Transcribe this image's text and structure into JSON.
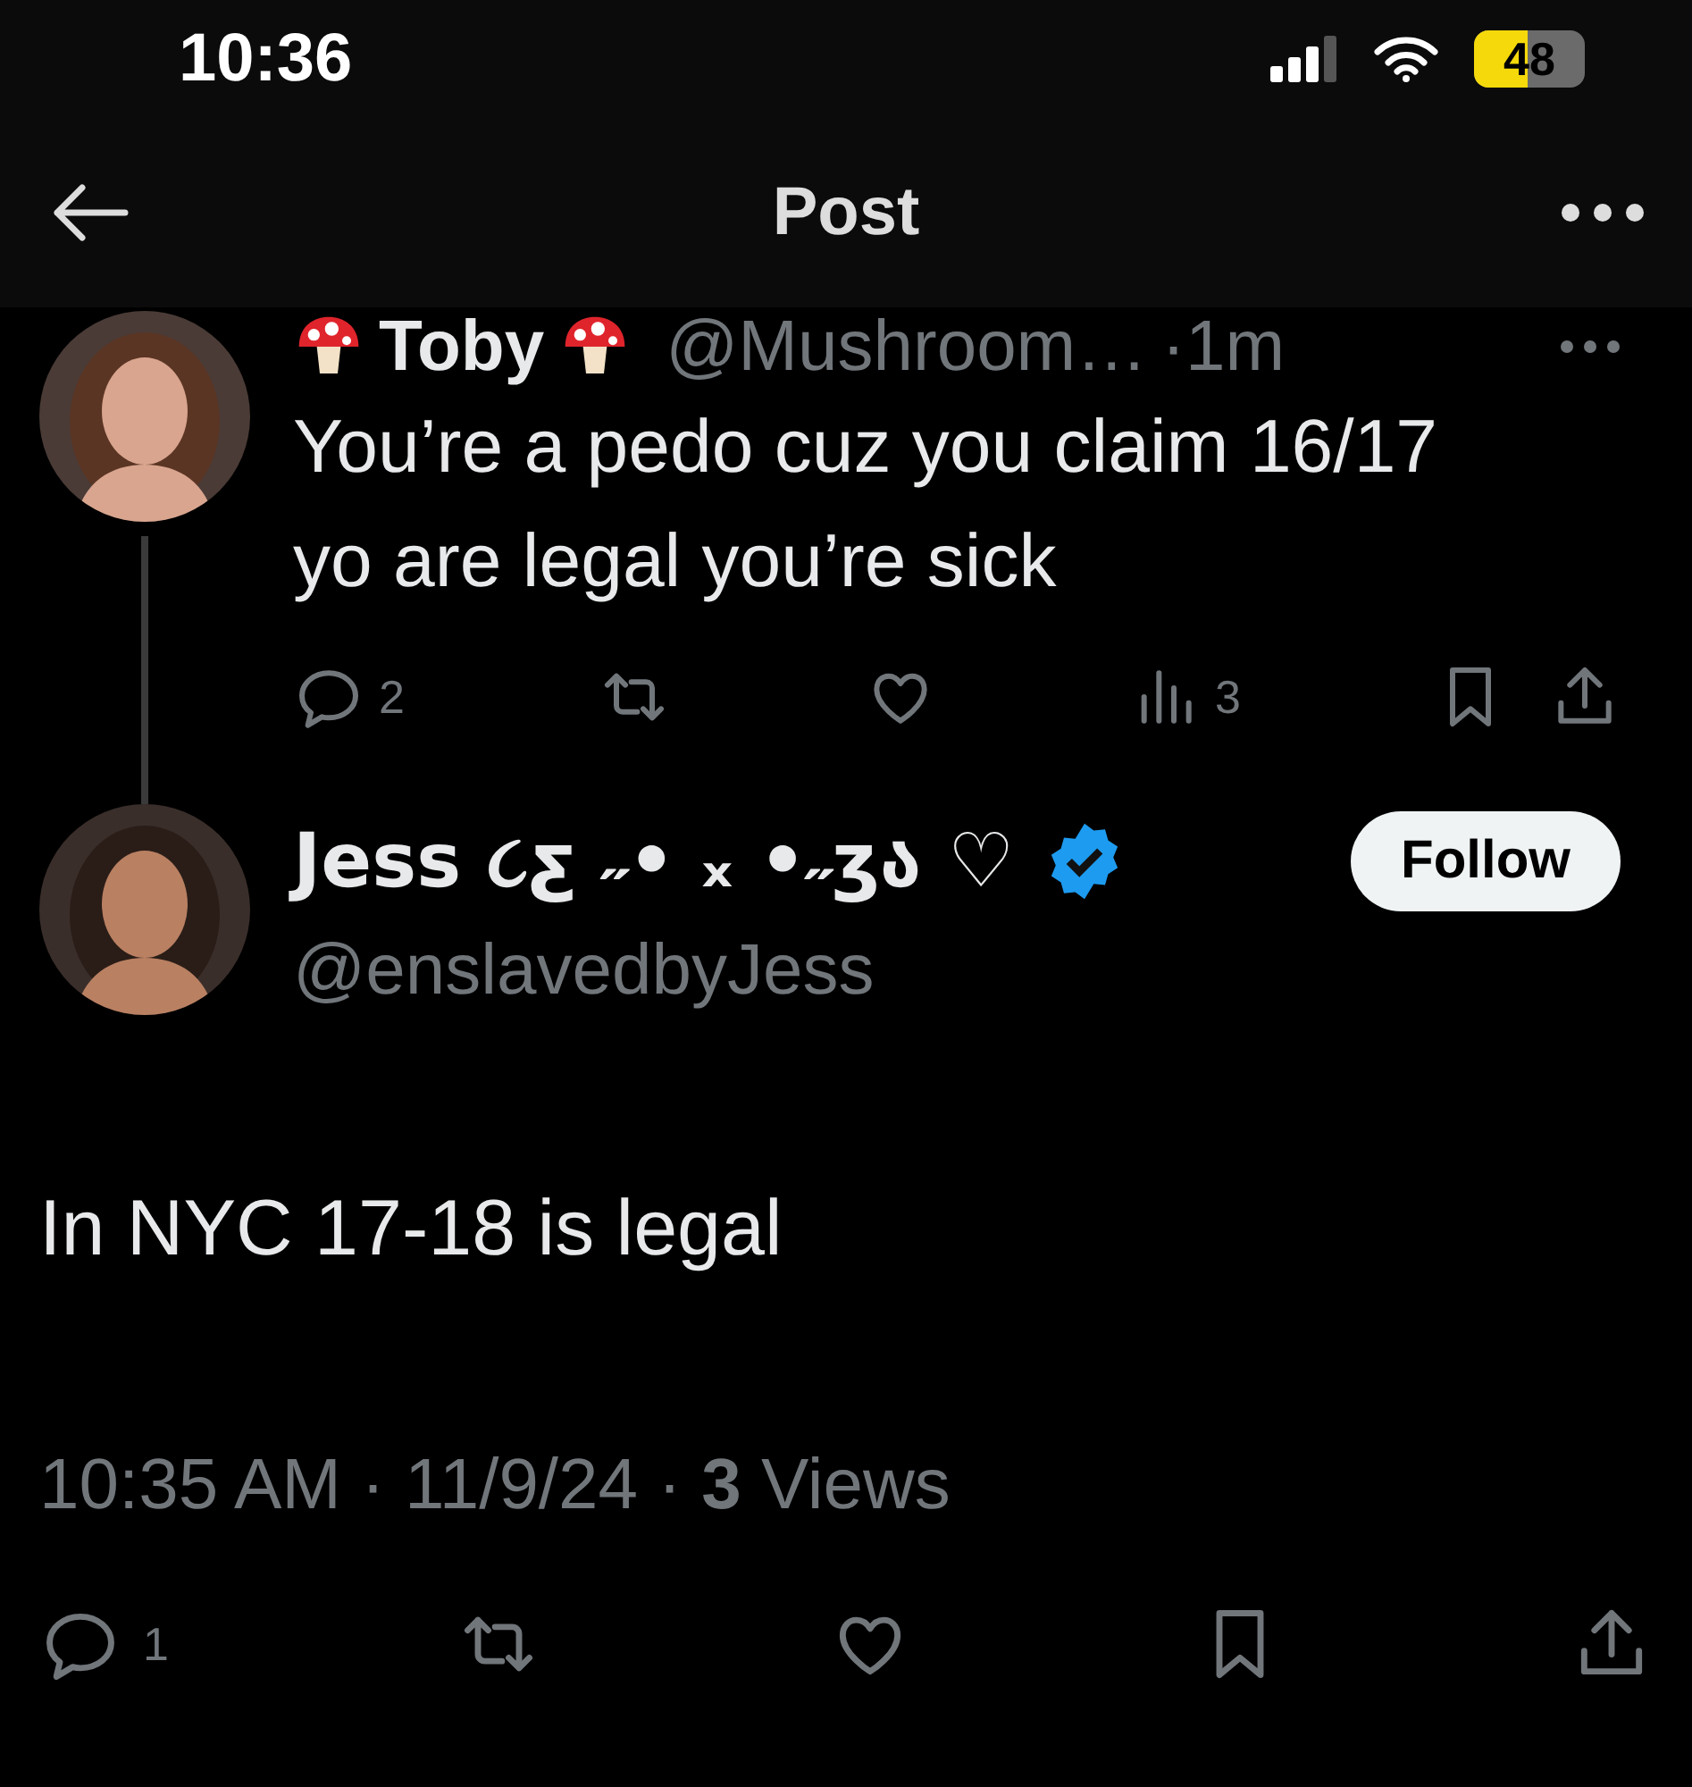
{
  "status_bar": {
    "time": "10:36",
    "battery": "48"
  },
  "header": {
    "title": "Post"
  },
  "reply_to": {
    "display_name": "Toby",
    "handle": "@Mushroom…",
    "time": "·1m",
    "text": "You’re a pedo cuz you claim 16/17 yo are legal you’re sick",
    "replies": "2",
    "views": "3"
  },
  "post": {
    "display_name": "Jess ૮ƹ ˶• ₓ •˶ʒა ♡",
    "verified": true,
    "follow_button": "Follow",
    "handle": "@enslavedbyJess",
    "text": "In NYC 17-18 is legal",
    "meta": "10:35 AM · 11/9/24 · **3** Views",
    "replies": "1"
  }
}
